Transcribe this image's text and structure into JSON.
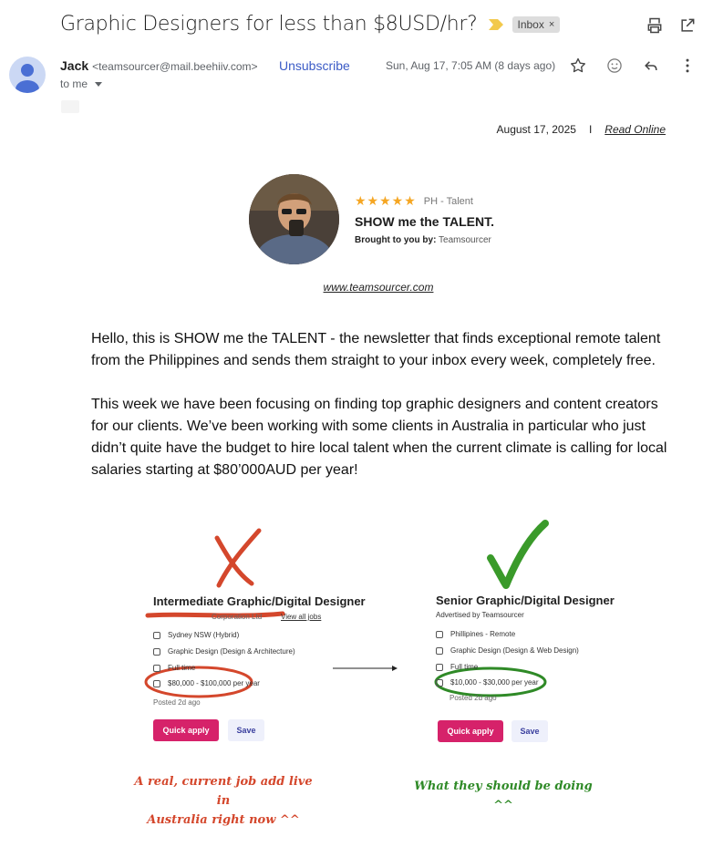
{
  "email": {
    "subject": "Graphic Designers for less than $8USD/hr?",
    "label_chip": "Inbox",
    "label_chip_close": "×",
    "sender_name": "Jack",
    "sender_email": "<teamsourcer@mail.beehiiv.com>",
    "unsubscribe": "Unsubscribe",
    "date": "Sun, Aug 17, 7:05 AM (8 days ago)",
    "recipient": "to me",
    "icons": [
      "print-icon",
      "open-in-new-window-icon",
      "star-icon",
      "emoji-react-icon",
      "reply-icon",
      "more-options-icon",
      "important-marker-icon",
      "dropdown-arrow-icon"
    ]
  },
  "newsletter": {
    "date": "August 17, 2025",
    "separator": "I",
    "read_online": "Read Online",
    "stars": "★★★★★",
    "stars_label": "PH - Talent",
    "brand_title": "SHOW me the TALENT.",
    "brought_by_label": "Brought to you by:",
    "brought_by_name": "Teamsourcer",
    "site_link": "www.teamsourcer.com",
    "paragraph_1": "Hello, this is SHOW me the TALENT - the newsletter that finds exceptional remote talent from the Philippines and sends them straight to your inbox every week, completely free.",
    "paragraph_2": "This week we have been focusing on finding top graphic designers and content creators for our clients. We’ve been working with some clients in Australia in particular who just didn’t quite have the budget to hire local talent when the current climate is calling for local salaries starting at $80’000AUD per year!"
  },
  "comparison": {
    "left": {
      "title": "Intermediate Graphic/Digital Designer",
      "company": "Corporation Ltd",
      "view_jobs": "View all jobs",
      "location": "Sydney NSW (Hybrid)",
      "category": "Graphic Design (Design & Architecture)",
      "work_type": "Full time",
      "salary": "$80,000 - $100,000 per year",
      "posted": "Posted 2d ago",
      "apply": "Quick apply",
      "save": "Save",
      "caption_line1": "A real, current job add live in",
      "caption_line2": "Australia right now ^^"
    },
    "right": {
      "title": "Senior Graphic/Digital Designer",
      "advertiser": "Advertised by Teamsourcer",
      "location": "Phillipines - Remote",
      "category": "Graphic Design (Design & Web Design)",
      "work_type": "Full time",
      "salary": "$10,000 - $30,000 per year",
      "posted": "Posted 2d ago",
      "apply": "Quick apply",
      "save": "Save",
      "caption": "What they should be doing ^^"
    },
    "colors": {
      "cross": "#d4472c",
      "check": "#3a9a2a",
      "apply_button": "#d6226a"
    }
  }
}
